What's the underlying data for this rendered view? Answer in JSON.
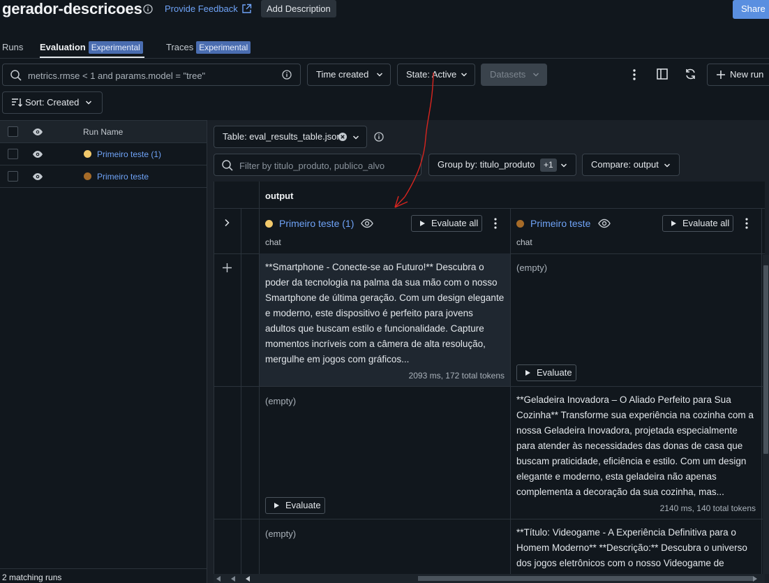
{
  "header": {
    "title": "gerador-descricoes",
    "feedback_label": "Provide Feedback",
    "add_description_label": "Add Description",
    "share_label": "Share"
  },
  "tabs": [
    {
      "label": "Runs",
      "badge": ""
    },
    {
      "label": "Evaluation",
      "badge": "Experimental",
      "active": true
    },
    {
      "label": "Traces",
      "badge": "Experimental"
    }
  ],
  "toolbar": {
    "search_placeholder": "metrics.rmse < 1 and params.model = \"tree\"",
    "time_created_label": "Time created",
    "state_label": "State: Active",
    "datasets_label": "Datasets",
    "new_run_label": "New run",
    "sort_label": "Sort: Created"
  },
  "runs_table": {
    "header_label": "Run Name",
    "rows": [
      {
        "name": "Primeiro teste (1)",
        "color": "#f2c96b"
      },
      {
        "name": "Primeiro teste",
        "color": "#a66b28"
      }
    ],
    "matching_label": "2 matching runs"
  },
  "evaluation": {
    "table_select_label": "Table: eval_results_table.json",
    "filter_placeholder": "Filter by titulo_produto, publico_alvo",
    "group_by_label": "Group by: titulo_produto",
    "group_by_extra": "+1",
    "compare_label": "Compare: output",
    "output_header": "output",
    "columns": [
      {
        "run": "Primeiro teste (1)",
        "subtitle": "chat",
        "color": "#f2c96b",
        "evaluate_all_label": "Evaluate all"
      },
      {
        "run": "Primeiro teste",
        "subtitle": "chat",
        "color": "#a66b28",
        "evaluate_all_label": "Evaluate all"
      }
    ],
    "rows": [
      {
        "c1_text": "**Smartphone - Conecte-se ao Futuro!** Descubra o poder da tecnologia na palma da sua mão com o nosso Smartphone de última geração. Com um design elegante e moderno, este dispositivo é perfeito para jovens adultos que buscam estilo e funcionalidade. Capture momentos incríveis com a câmera de alta resolução, mergulhe em jogos com gráficos...",
        "c1_meta": "2093 ms, 172 total tokens",
        "c2_text": "(empty)",
        "c2_evaluate": "Evaluate"
      },
      {
        "c1_text": "(empty)",
        "c1_evaluate": "Evaluate",
        "c2_text": "**Geladeira Inovadora – O Aliado Perfeito para Sua Cozinha** Transforme sua experiência na cozinha com a nossa Geladeira Inovadora, projetada especialmente para atender às necessidades das donas de casa que buscam praticidade, eficiência e estilo. Com um design elegante e moderno, esta geladeira não apenas complementa a decoração da sua cozinha, mas...",
        "c2_meta": "2140 ms, 140 total tokens"
      },
      {
        "c1_text": "(empty)",
        "c2_text": "**Título: Videogame - A Experiência Definitiva para o Homem Moderno** **Descrição:** Descubra o universo dos jogos eletrônicos com o nosso Videogame de"
      }
    ]
  }
}
